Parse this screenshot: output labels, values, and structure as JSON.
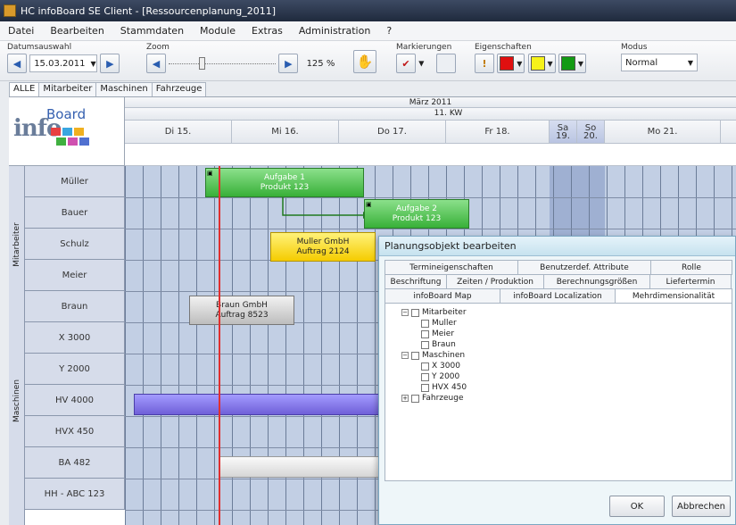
{
  "window": {
    "title": "HC infoBoard SE Client - [Ressourcenplanung_2011]"
  },
  "menu": [
    "Datei",
    "Bearbeiten",
    "Stammdaten",
    "Module",
    "Extras",
    "Administration",
    "?"
  ],
  "toolbar": {
    "date_label": "Datumsauswahl",
    "date_value": "15.03.2011",
    "zoom_label": "Zoom",
    "zoom_value": "125 %",
    "markers_label": "Markierungen",
    "props_label": "Eigenschaften",
    "mode_label": "Modus",
    "mode_value": "Normal"
  },
  "tabs": [
    "ALLE",
    "Mitarbeiter",
    "Maschinen",
    "Fahrzeuge"
  ],
  "header": {
    "month": "März 2011",
    "week": "11. KW",
    "days": [
      "Di 15.",
      "Mi 16.",
      "Do 17.",
      "Fr 18.",
      "Sa\n19.",
      "So\n20.",
      "Mo 21."
    ]
  },
  "groups": {
    "staff": "Mitarbeiter",
    "machines": "Maschinen"
  },
  "rows": [
    "Müller",
    "Bauer",
    "Schulz",
    "Meier",
    "Braun",
    "X 3000",
    "Y 2000",
    "HV 4000",
    "HVX 450",
    "BA 482",
    "HH - ABC 123"
  ],
  "bars": {
    "task1_line1": "Aufgabe 1",
    "task1_line2": "Produkt 123",
    "task2_line1": "Aufgabe 2",
    "task2_line2": "Produkt 123",
    "order1_line1": "Muller GmbH",
    "order1_line2": "Auftrag 2124",
    "order2_line1": "Braun GmbH",
    "order2_line2": "Auftrag 8523"
  },
  "dialog": {
    "title": "Planungsobjekt bearbeiten",
    "tab_row1": [
      "Termineigenschaften",
      "Benutzerdef. Attribute",
      "Rolle"
    ],
    "tab_row2": [
      "Beschriftung",
      "Zeiten / Produktion",
      "Berechnungsgrößen",
      "Liefertermin"
    ],
    "tab_row3": [
      "infoBoard Map",
      "infoBoard Localization",
      "Mehrdimensionalität"
    ],
    "tree": {
      "staff": "Mitarbeiter",
      "staff_items": [
        "Muller",
        "Meier",
        "Braun"
      ],
      "machines": "Maschinen",
      "machine_items": [
        "X 3000",
        "Y 2000",
        "HVX 450"
      ],
      "vehicles": "Fahrzeuge"
    },
    "ok": "OK",
    "cancel": "Abbrechen"
  },
  "colors": {
    "now_line": "#e03030",
    "bar_green": "#38b038",
    "bar_yellow": "#f5cc00",
    "bar_purple": "#6f5fd8"
  }
}
